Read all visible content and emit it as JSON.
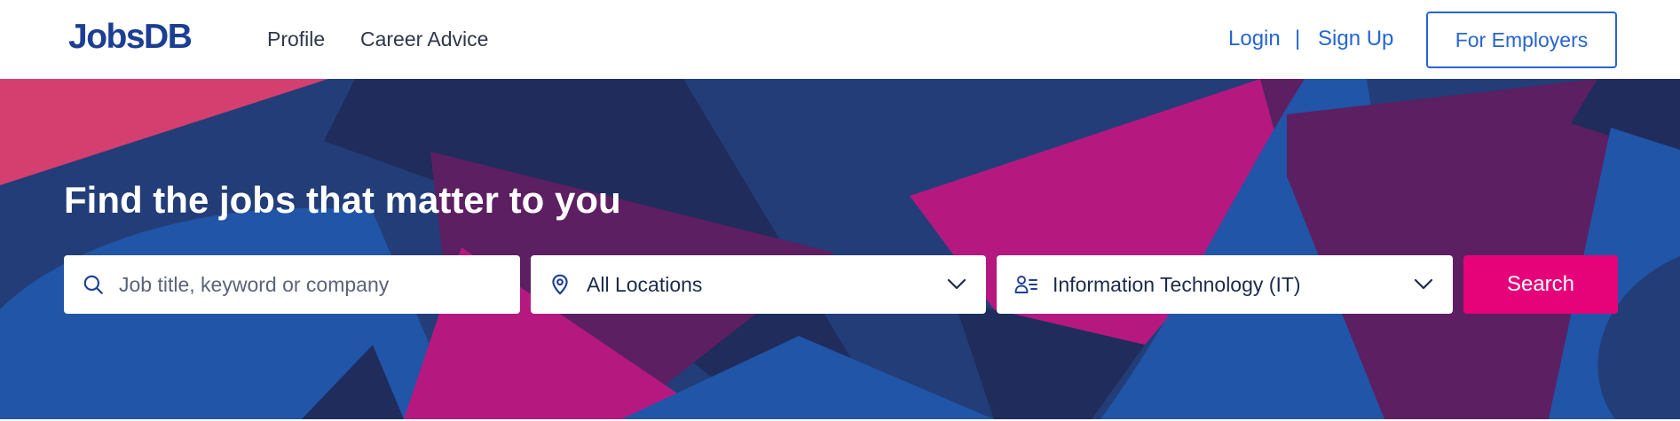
{
  "header": {
    "logo": "JobsDB",
    "nav": [
      {
        "label": "Profile"
      },
      {
        "label": "Career Advice"
      }
    ],
    "auth": {
      "login": "Login",
      "separator": "|",
      "signup": "Sign Up"
    },
    "employers_button": "For Employers"
  },
  "hero": {
    "title": "Find the jobs that matter to you",
    "colors": {
      "navy": "#223d78",
      "dark_navy": "#1f2c5c",
      "blue": "#2055a8",
      "magenta": "#b5197f",
      "plum": "#5c1f62",
      "pink": "#d43f6f"
    },
    "search": {
      "keyword_placeholder": "Job title, keyword or company",
      "keyword_value": "",
      "location_value": "All Locations",
      "classification_value": "Information Technology (IT)",
      "search_button": "Search",
      "icons": {
        "keyword": "search-icon",
        "location": "location-pin-icon",
        "classification": "person-list-icon",
        "dropdown": "chevron-down-icon"
      }
    }
  },
  "theme": {
    "brand": "#1c3f94",
    "link": "#2765cf",
    "accent": "#e60278"
  }
}
